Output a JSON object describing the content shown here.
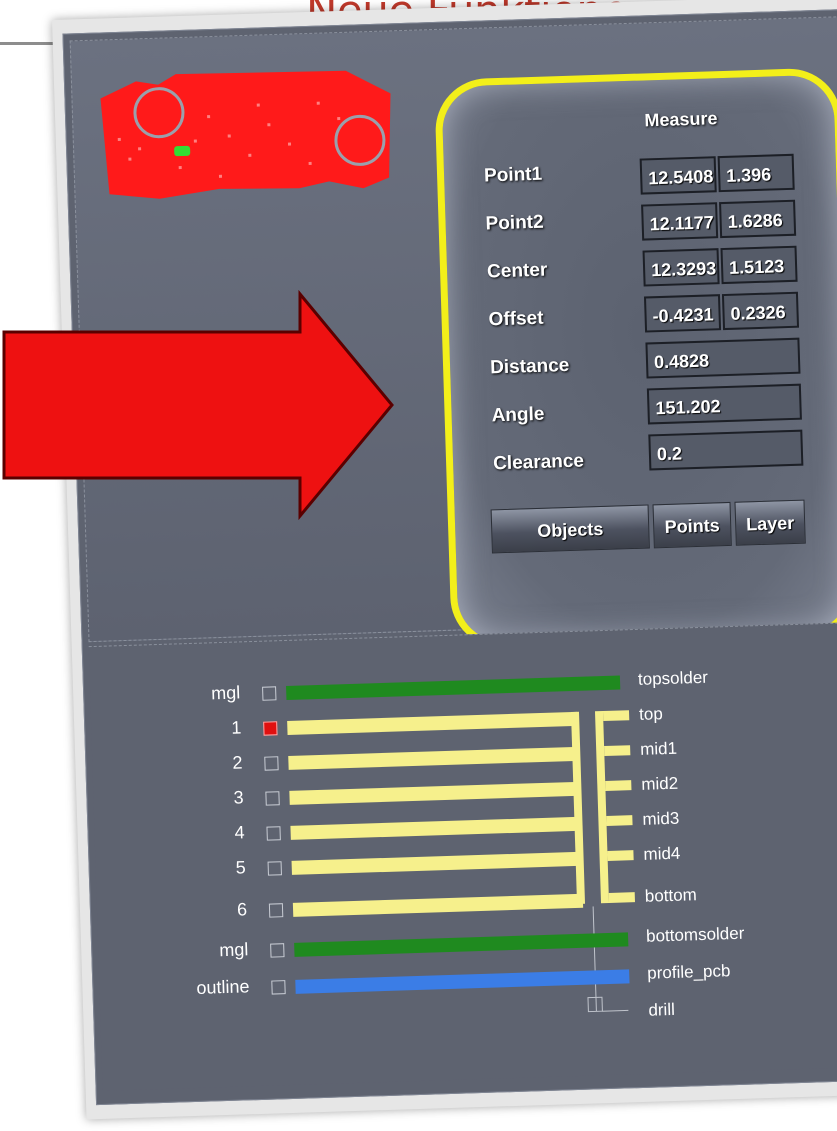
{
  "slide": {
    "title": "Neue Funktionen – G"
  },
  "measure": {
    "title": "Measure",
    "rows": [
      {
        "label": "Point1",
        "values": [
          "12.5408",
          "1.396"
        ]
      },
      {
        "label": "Point2",
        "values": [
          "12.1177",
          "1.6286"
        ]
      },
      {
        "label": "Center",
        "values": [
          "12.3293",
          "1.5123"
        ]
      },
      {
        "label": "Offset",
        "values": [
          "-0.4231",
          "0.2326"
        ]
      },
      {
        "label": "Distance",
        "values": [
          "0.4828"
        ]
      },
      {
        "label": "Angle",
        "values": [
          "151.202"
        ]
      },
      {
        "label": "Clearance",
        "values": [
          "0.2"
        ]
      }
    ],
    "buttons": {
      "objects": "Objects",
      "points": "Points",
      "layer": "Layer"
    }
  },
  "layers": [
    {
      "num": "mgl",
      "name": "topsolder",
      "checked": false,
      "color": "#1f8a1f"
    },
    {
      "num": "1",
      "name": "top",
      "checked": true,
      "color": "#f6f08c"
    },
    {
      "num": "2",
      "name": "mid1",
      "checked": false,
      "color": "#f6f08c"
    },
    {
      "num": "3",
      "name": "mid2",
      "checked": false,
      "color": "#f6f08c"
    },
    {
      "num": "4",
      "name": "mid3",
      "checked": false,
      "color": "#f6f08c"
    },
    {
      "num": "5",
      "name": "mid4",
      "checked": false,
      "color": "#f6f08c"
    },
    {
      "num": "6",
      "name": "bottom",
      "checked": false,
      "color": "#f6f08c"
    },
    {
      "num": "mgl",
      "name": "bottomsolder",
      "checked": false,
      "color": "#1f8a1f"
    },
    {
      "num": "outline",
      "name": "profile_pcb",
      "checked": false,
      "color": "#3b7de6"
    },
    {
      "num": "",
      "name": "drill",
      "checked": false,
      "color": ""
    }
  ],
  "colors": {
    "accent_title": "#c0392b",
    "highlight_ring": "#f3ef1a",
    "arrow": "#ee1111",
    "pcb": "#ff1a1a",
    "selected_part": "#33dd33"
  },
  "icons": {
    "arrow": "right-arrow-icon",
    "checkbox": "checkbox-icon"
  }
}
